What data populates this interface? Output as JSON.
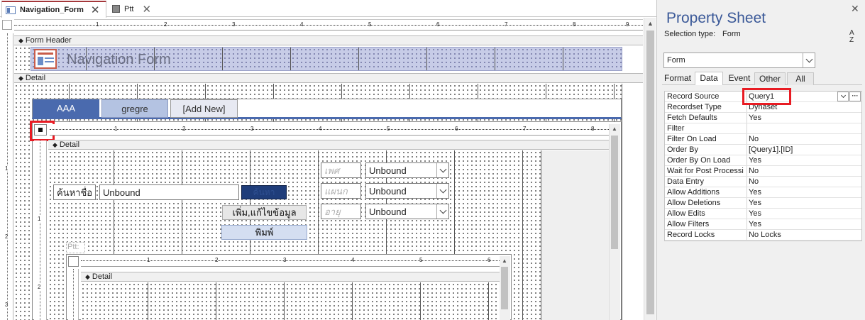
{
  "doc_tabs": [
    {
      "label": "Navigation_Form",
      "active": true
    },
    {
      "label": "Ptt",
      "active": false
    }
  ],
  "sections": {
    "form_header": "Form Header",
    "detail": "Detail",
    "sub_detail": "Detail",
    "sub2_detail": "Detail"
  },
  "header_title": "Navigation Form",
  "nav_tabs": [
    "AAA",
    "gregre",
    "[Add New]"
  ],
  "ruler_numbers": [
    "1",
    "2",
    "3",
    "4",
    "5",
    "6",
    "7",
    "8",
    "9"
  ],
  "sub_ruler_numbers": [
    "1",
    "2",
    "3",
    "4",
    "5",
    "6",
    "7",
    "8"
  ],
  "sub2_ruler_numbers": [
    "1",
    "2",
    "3",
    "4",
    "5",
    "6"
  ],
  "vruler_numbers": [
    "1",
    "2",
    "3"
  ],
  "sub_vruler_numbers": [
    "1",
    "2"
  ],
  "subform": {
    "search_label": "ค้นหาชื่อ",
    "search_value": "Unbound",
    "search_button": "ค้นหา",
    "add_edit_button": "เพิ่ม,แก้ไขข้อมูล",
    "print_button": "พิมพ์",
    "combos": [
      {
        "label": "เพศ",
        "value": "Unbound"
      },
      {
        "label": "แผนก",
        "value": "Unbound"
      },
      {
        "label": "อายุ",
        "value": "Unbound"
      }
    ],
    "subform_label": "Ptt:"
  },
  "property_sheet": {
    "title": "Property Sheet",
    "selection_type_label": "Selection type:",
    "selection_type_value": "Form",
    "object_select": "Form",
    "sort_glyph_a": "A",
    "sort_glyph_z": "Z",
    "tabs": [
      "Format",
      "Data",
      "Event",
      "Other",
      "All"
    ],
    "active_tab": "Data",
    "ellipsis": "···",
    "rows": [
      {
        "key": "Record Source",
        "value": "Query1"
      },
      {
        "key": "Recordset Type",
        "value": "Dynaset"
      },
      {
        "key": "Fetch Defaults",
        "value": "Yes"
      },
      {
        "key": "Filter",
        "value": ""
      },
      {
        "key": "Filter On Load",
        "value": "No"
      },
      {
        "key": "Order By",
        "value": "[Query1].[ID]"
      },
      {
        "key": "Order By On Load",
        "value": "Yes"
      },
      {
        "key": "Wait for Post Processi",
        "value": "No"
      },
      {
        "key": "Data Entry",
        "value": "No"
      },
      {
        "key": "Allow Additions",
        "value": "Yes"
      },
      {
        "key": "Allow Deletions",
        "value": "Yes"
      },
      {
        "key": "Allow Edits",
        "value": "Yes"
      },
      {
        "key": "Allow Filters",
        "value": "Yes"
      },
      {
        "key": "Record Locks",
        "value": "No Locks"
      }
    ]
  },
  "colors": {
    "highlight_red": "#e81b23",
    "nav_active": "#4a6aae",
    "nav_inactive": "#b4c3e2",
    "header_band": "#c7cce7",
    "search_button": "#1f3d7a",
    "panel_bg": "#f0f0f0"
  }
}
